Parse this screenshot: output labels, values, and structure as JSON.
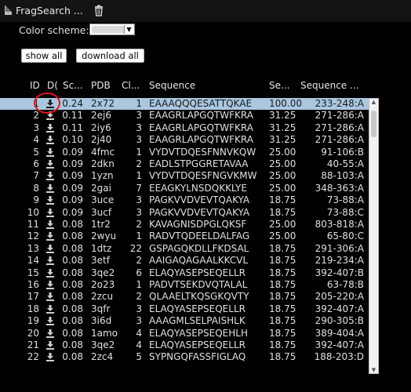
{
  "panel": {
    "title": "FragSearch ...",
    "color_scheme_label": "Color scheme:"
  },
  "buttons": {
    "show_all": "show all",
    "download_all": "download all"
  },
  "columns": [
    "ID",
    "D(",
    "Sc...",
    "PDB",
    "Cl...",
    "Sequence",
    "Se...",
    "Sequence ..."
  ],
  "rows": [
    {
      "id": "1",
      "score": "0.24",
      "pdb": "2x72",
      "cl": "1",
      "seq": "EAAAQQQESATTQKAE",
      "si": "100.00",
      "range": "233-248:A"
    },
    {
      "id": "2",
      "score": "0.11",
      "pdb": "2ej6",
      "cl": "3",
      "seq": "EAAGRLAPGQTWFKRA",
      "si": "31.25",
      "range": "271-286:A"
    },
    {
      "id": "3",
      "score": "0.11",
      "pdb": "2iy6",
      "cl": "3",
      "seq": "EAAGRLAPGQTWFKRA",
      "si": "31.25",
      "range": "271-286:A"
    },
    {
      "id": "4",
      "score": "0.10",
      "pdb": "2j40",
      "cl": "3",
      "seq": "EAAGRLAPGQTWFKRA",
      "si": "31.25",
      "range": "271-286:A"
    },
    {
      "id": "5",
      "score": "0.09",
      "pdb": "4fmc",
      "cl": "1",
      "seq": "VYDVTDQESFNNVKQW",
      "si": "25.00",
      "range": "91-106:B"
    },
    {
      "id": "6",
      "score": "0.09",
      "pdb": "2dkn",
      "cl": "2",
      "seq": "EADLSTPGGRETAVAA",
      "si": "25.00",
      "range": "40-55:A"
    },
    {
      "id": "7",
      "score": "0.09",
      "pdb": "1yzn",
      "cl": "1",
      "seq": "VYDVTDQESFNGVKMW",
      "si": "25.00",
      "range": "88-103:A"
    },
    {
      "id": "8",
      "score": "0.09",
      "pdb": "2gai",
      "cl": "7",
      "seq": "EEAGKYLNSDQKKLYE",
      "si": "25.00",
      "range": "348-363:A"
    },
    {
      "id": "9",
      "score": "0.09",
      "pdb": "3uce",
      "cl": "3",
      "seq": "PAGKVVDVEVTQAKYA",
      "si": "18.75",
      "range": "73-88:A"
    },
    {
      "id": "10",
      "score": "0.09",
      "pdb": "3ucf",
      "cl": "3",
      "seq": "PAGKVVDVEVTQAKYA",
      "si": "18.75",
      "range": "73-88:C"
    },
    {
      "id": "11",
      "score": "0.08",
      "pdb": "1tr2",
      "cl": "2",
      "seq": "KAVAGNISDPGLQKSF",
      "si": "25.00",
      "range": "803-818:A"
    },
    {
      "id": "12",
      "score": "0.08",
      "pdb": "2wyu",
      "cl": "1",
      "seq": "RADVTQDEELDALFAG",
      "si": "25.00",
      "range": "65-80:C"
    },
    {
      "id": "13",
      "score": "0.08",
      "pdb": "1dtz",
      "cl": "22",
      "seq": "GSPAGQKDLLFKDSAL",
      "si": "18.75",
      "range": "291-306:A"
    },
    {
      "id": "14",
      "score": "0.08",
      "pdb": "3etf",
      "cl": "2",
      "seq": "AAIGAQAGAALKKCVL",
      "si": "18.75",
      "range": "219-234:A"
    },
    {
      "id": "15",
      "score": "0.08",
      "pdb": "3qe2",
      "cl": "6",
      "seq": "ELAQYASEPSEQELLR",
      "si": "18.75",
      "range": "392-407:B"
    },
    {
      "id": "16",
      "score": "0.08",
      "pdb": "2o23",
      "cl": "1",
      "seq": "PADVTSEKDVQTALAL",
      "si": "18.75",
      "range": "63-78:B"
    },
    {
      "id": "17",
      "score": "0.08",
      "pdb": "2zcu",
      "cl": "2",
      "seq": "QLAAELTKQSGKQVTY",
      "si": "18.75",
      "range": "205-220:A"
    },
    {
      "id": "18",
      "score": "0.08",
      "pdb": "3qfr",
      "cl": "3",
      "seq": "ELAQYASEPSEQELLR",
      "si": "18.75",
      "range": "392-407:A"
    },
    {
      "id": "19",
      "score": "0.08",
      "pdb": "3i6d",
      "cl": "3",
      "seq": "AAAGMLSELPAISHLK",
      "si": "18.75",
      "range": "290-305:B"
    },
    {
      "id": "20",
      "score": "0.08",
      "pdb": "1amo",
      "cl": "4",
      "seq": "ELAQYASEPSEQEHLH",
      "si": "18.75",
      "range": "389-404:A"
    },
    {
      "id": "21",
      "score": "0.08",
      "pdb": "3qe2",
      "cl": "4",
      "seq": "ELAQYASEPSEQELLR",
      "si": "18.75",
      "range": "392-407:A"
    },
    {
      "id": "22",
      "score": "0.08",
      "pdb": "2zc4",
      "cl": "5",
      "seq": "SYPNGQFASSFIGLAQ",
      "si": "18.75",
      "range": "188-203:D"
    }
  ],
  "colors": {
    "selected_row": "#aac7df",
    "highlight_circle": "#e3141b"
  }
}
